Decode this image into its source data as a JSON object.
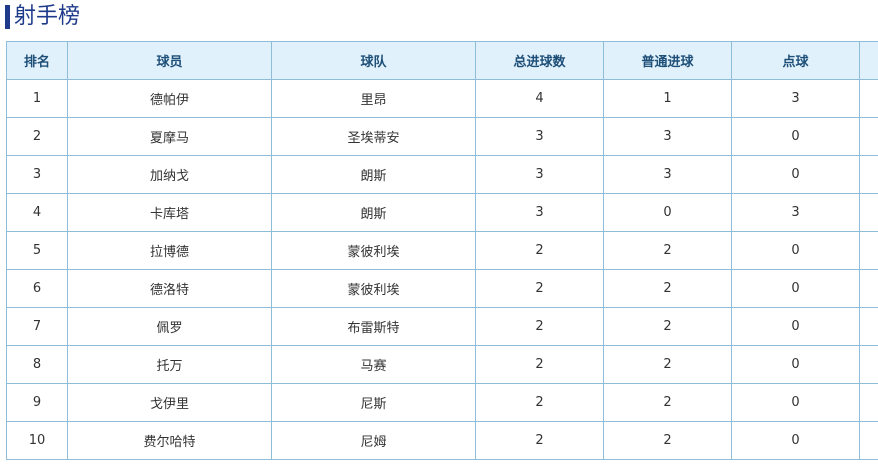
{
  "title": "射手榜",
  "columns": [
    "排名",
    "球员",
    "球队",
    "总进球数",
    "普通进球",
    "点球"
  ],
  "rows": [
    [
      "1",
      "德帕伊",
      "里昂",
      "4",
      "1",
      "3"
    ],
    [
      "2",
      "夏摩马",
      "圣埃蒂安",
      "3",
      "3",
      "0"
    ],
    [
      "3",
      "加纳戈",
      "朗斯",
      "3",
      "3",
      "0"
    ],
    [
      "4",
      "卡库塔",
      "朗斯",
      "3",
      "0",
      "3"
    ],
    [
      "5",
      "拉博德",
      "蒙彼利埃",
      "2",
      "2",
      "0"
    ],
    [
      "6",
      "德洛特",
      "蒙彼利埃",
      "2",
      "2",
      "0"
    ],
    [
      "7",
      "佩罗",
      "布雷斯特",
      "2",
      "2",
      "0"
    ],
    [
      "8",
      "托万",
      "马赛",
      "2",
      "2",
      "0"
    ],
    [
      "9",
      "戈伊里",
      "尼斯",
      "2",
      "2",
      "0"
    ],
    [
      "10",
      "费尔哈特",
      "尼姆",
      "2",
      "2",
      "0"
    ]
  ],
  "colors": {
    "accent": "#1e3a8a",
    "header_bg": "#e1f1fb",
    "border": "#8fbcd6"
  }
}
